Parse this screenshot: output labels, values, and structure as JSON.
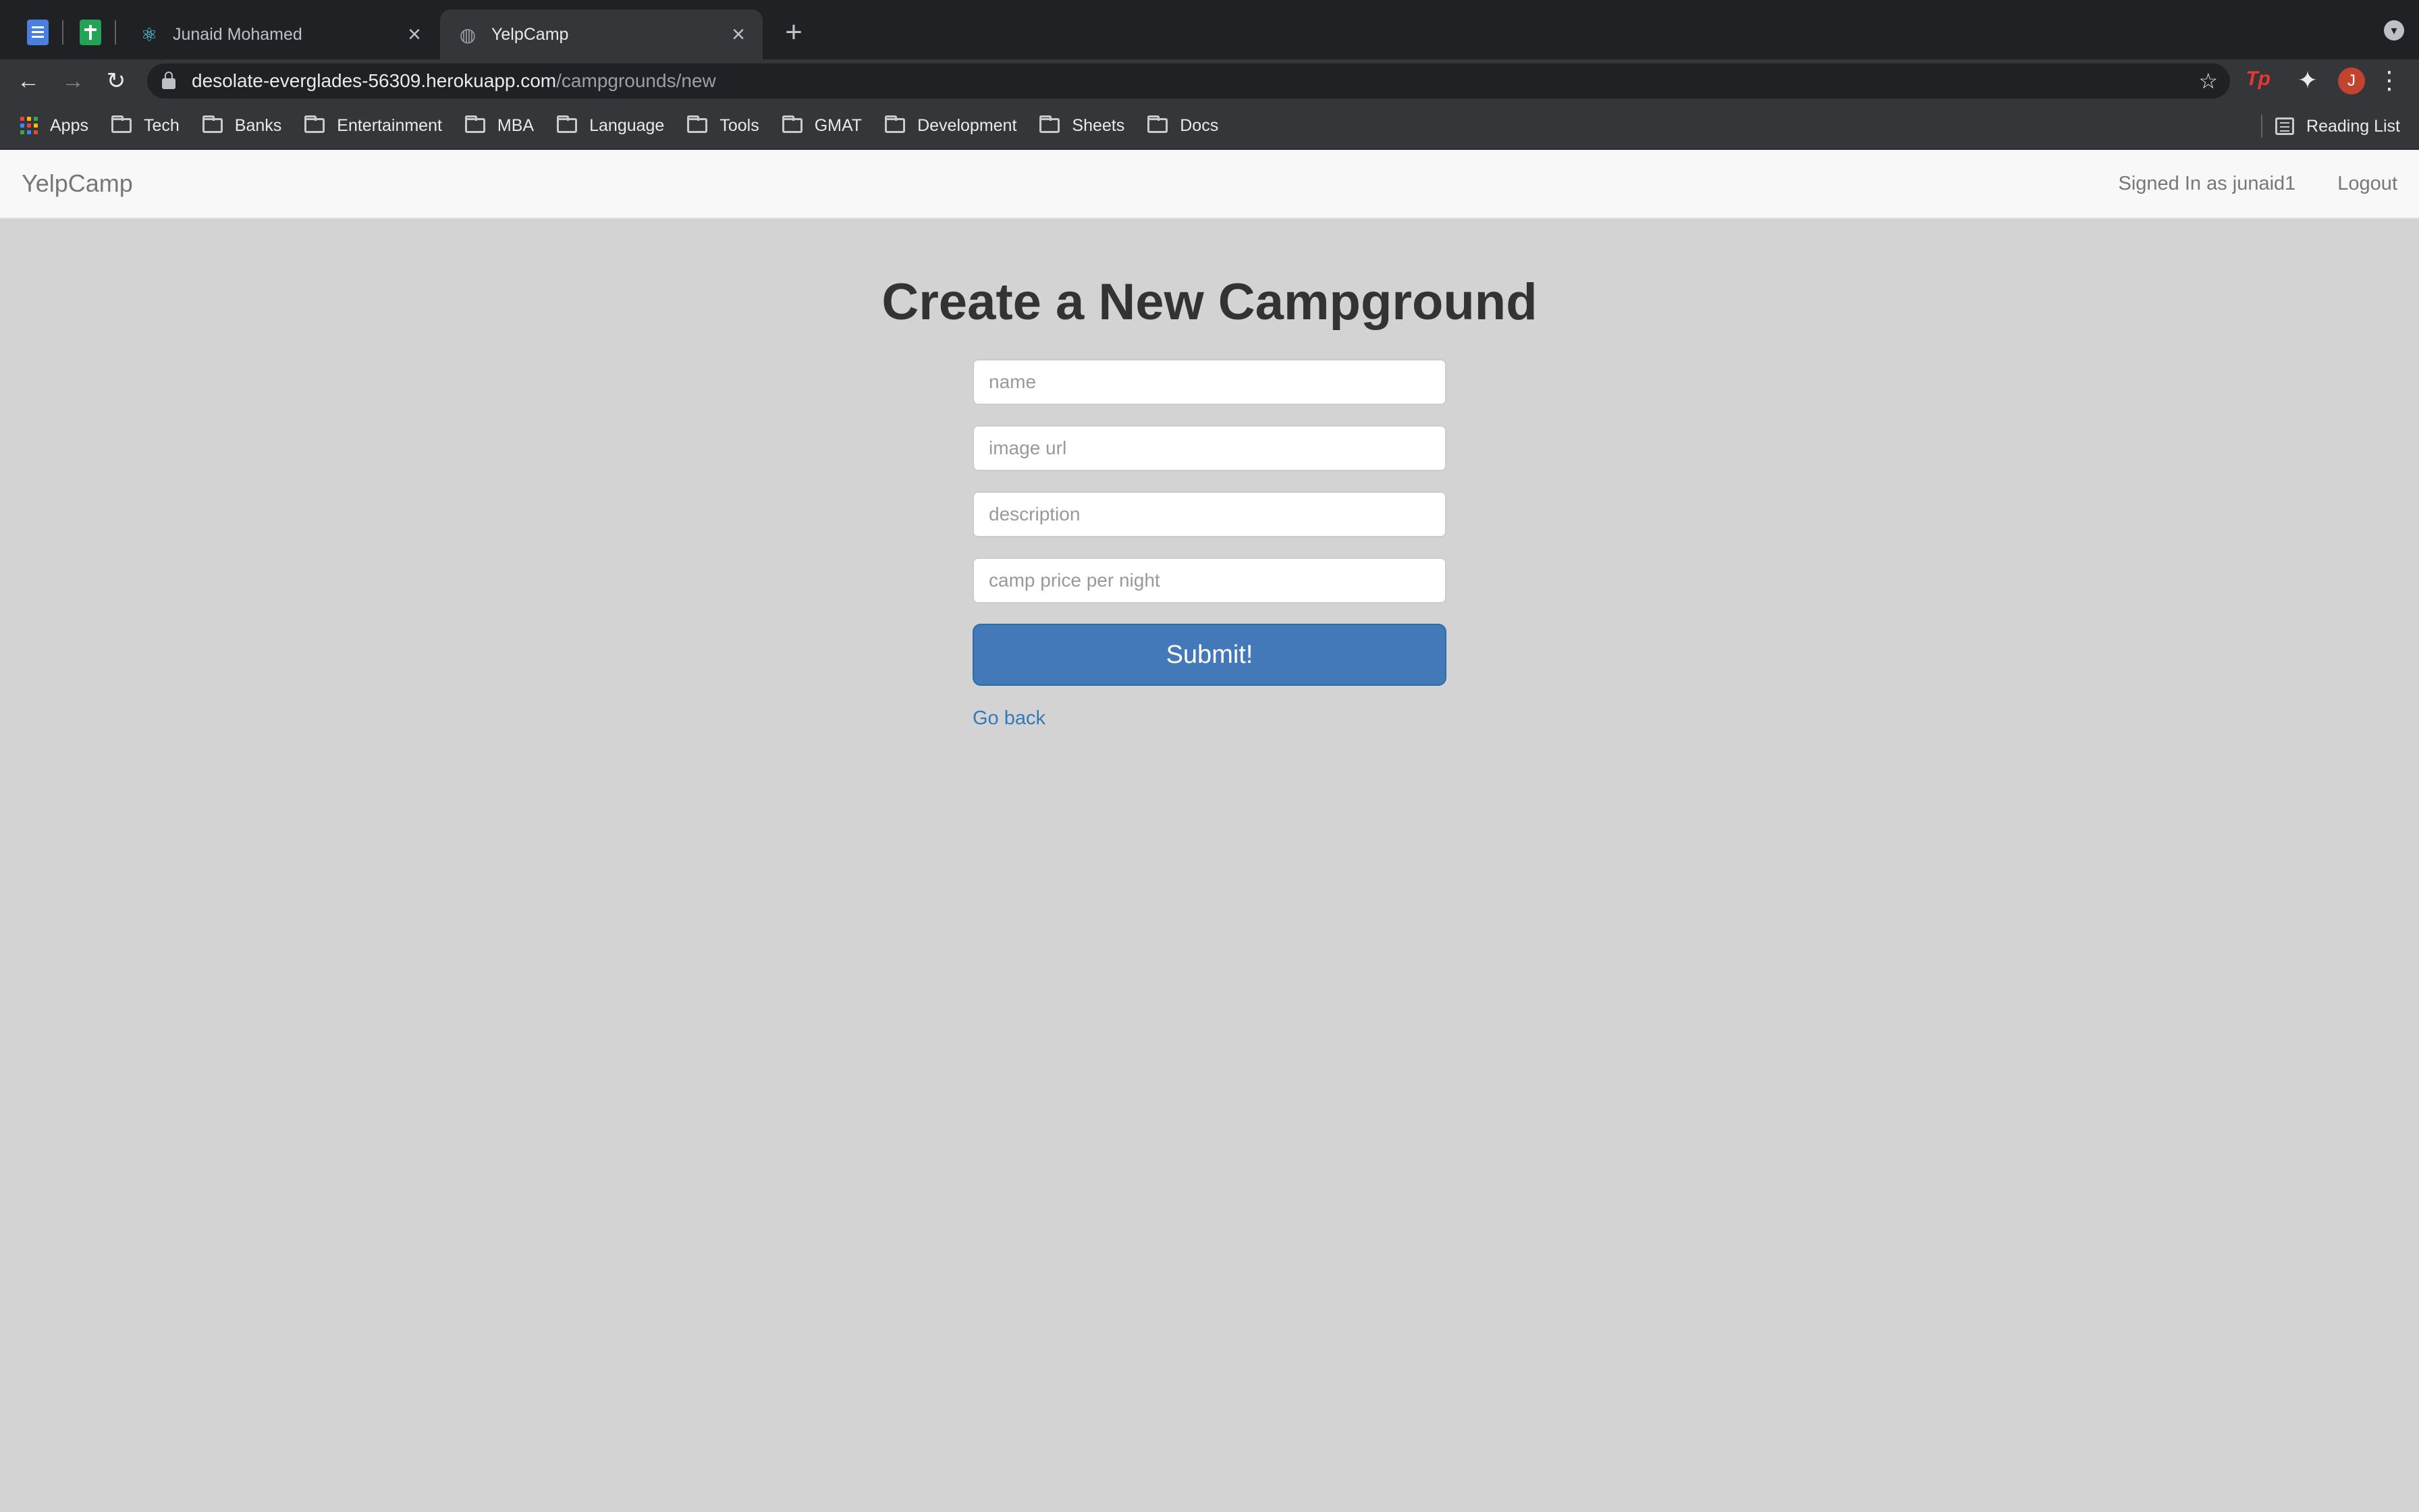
{
  "browser": {
    "tabs": [
      {
        "title": "Junaid Mohamed",
        "favicon": "react-atom-icon"
      },
      {
        "title": "YelpCamp",
        "favicon": "globe-icon"
      }
    ],
    "url": {
      "host": "desolate-everglades-56309.herokuapp.com",
      "path": "/campgrounds/new"
    },
    "avatar_initial": "J",
    "extension_label": "Tp",
    "bookmarks": [
      {
        "label": "Apps"
      },
      {
        "label": "Tech"
      },
      {
        "label": "Banks"
      },
      {
        "label": "Entertainment"
      },
      {
        "label": "MBA"
      },
      {
        "label": "Language"
      },
      {
        "label": "Tools"
      },
      {
        "label": "GMAT"
      },
      {
        "label": "Development"
      },
      {
        "label": "Sheets"
      },
      {
        "label": "Docs"
      }
    ],
    "reading_list": "Reading List"
  },
  "navbar": {
    "brand": "YelpCamp",
    "signed_in": "Signed In as junaid1",
    "logout": "Logout"
  },
  "page": {
    "title": "Create a New Campground",
    "form": {
      "name_placeholder": "name",
      "image_placeholder": "image url",
      "description_placeholder": "description",
      "price_placeholder": "camp price per night",
      "submit_label": "Submit!"
    },
    "go_back": "Go back"
  },
  "colors": {
    "page_background": "#d3d3d3",
    "submit_button": "#4479b9",
    "link": "#337ab7",
    "navbar_background": "#f8f8f8"
  }
}
